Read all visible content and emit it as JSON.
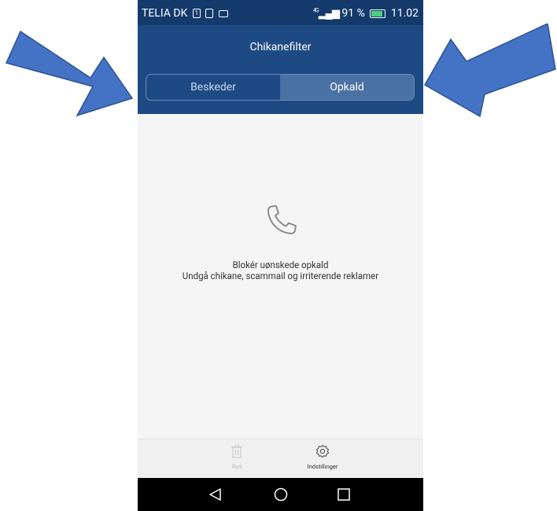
{
  "status": {
    "carrier": "TELIA DK",
    "network": "4G",
    "battery": "91 %",
    "time": "11.02"
  },
  "app": {
    "title": "Chikanefilter"
  },
  "tabs": [
    {
      "label": "Beskeder",
      "active": false
    },
    {
      "label": "Opkald",
      "active": true
    }
  ],
  "empty_state": {
    "line1": "Blokér uønskede opkald",
    "line2": "Undgå chikane, scammail og irriterende reklamer"
  },
  "bottom_bar": {
    "clear_label": "Ryd",
    "settings_label": "Indstillinger"
  },
  "colors": {
    "header": "#1e4a84",
    "statusbar": "#143a6c",
    "active_tab": "#4a71a3",
    "arrow_fill": "#4472c4",
    "arrow_stroke": "#2f528f"
  }
}
